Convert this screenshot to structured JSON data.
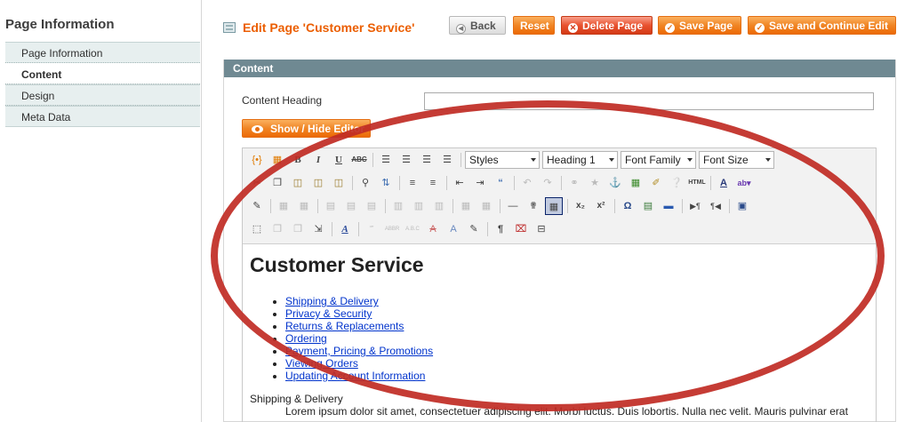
{
  "sidebar": {
    "title": "Page Information",
    "tabs": [
      {
        "label": "Page Information",
        "active": false
      },
      {
        "label": "Content",
        "active": true
      },
      {
        "label": "Design",
        "active": false
      },
      {
        "label": "Meta Data",
        "active": false
      }
    ]
  },
  "header": {
    "title": "Edit Page 'Customer Service'",
    "buttons": {
      "back": "Back",
      "reset": "Reset",
      "delete": "Delete Page",
      "save": "Save Page",
      "save_continue": "Save and Continue Edit"
    }
  },
  "section": {
    "title": "Content",
    "content_heading_label": "Content Heading",
    "content_heading_value": "",
    "show_hide_editor": "Show / Hide Editor"
  },
  "toolbar": {
    "styles": "Styles",
    "format": "Heading 1",
    "font_family": "Font Family",
    "font_size": "Font Size"
  },
  "editor": {
    "heading": "Customer Service",
    "links": [
      "Shipping & Delivery",
      "Privacy & Security",
      "Returns & Replacements",
      "Ordering",
      "Payment, Pricing & Promotions",
      "Viewing Orders",
      "Updating Account Information"
    ],
    "subheading": "Shipping & Delivery",
    "paragraph": "Lorem ipsum dolor sit amet, consectetuer adipiscing elit. Morbi luctus. Duis lobortis. Nulla nec velit. Mauris pulvinar erat"
  },
  "colors": {
    "accent": "#eb5e00",
    "section_header": "#6f8992",
    "annotation": "#c02b24"
  }
}
